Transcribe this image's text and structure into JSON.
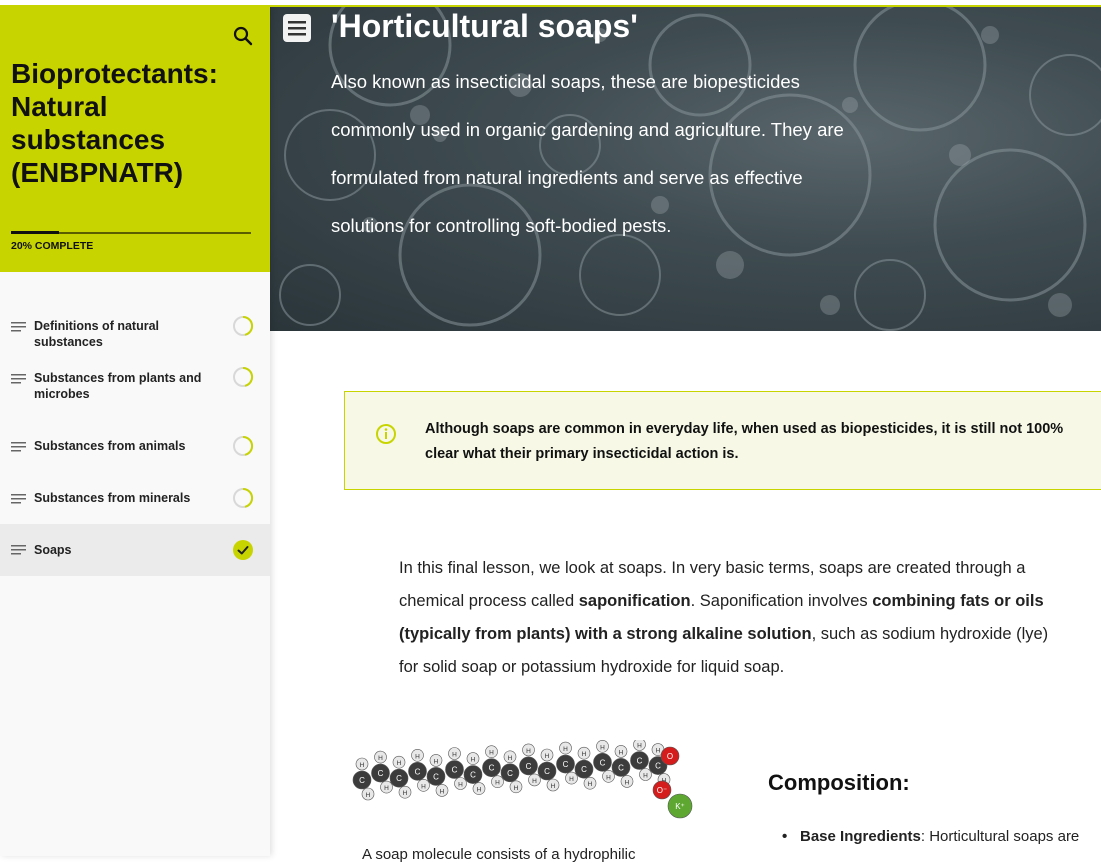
{
  "colors": {
    "accent": "#c8d400",
    "check": "#c8d400",
    "note_bg": "#f7f9e6"
  },
  "sidebar": {
    "search_icon": "search-icon",
    "course_title": "Bioprotectants: Natural substances (ENBPNATR)",
    "progress_percent": 20,
    "progress_label": "20% COMPLETE",
    "lessons": [
      {
        "label": "Definitions of natural substances",
        "status": "partial"
      },
      {
        "label": "Substances from plants and microbes",
        "status": "partial"
      },
      {
        "label": "Substances from animals",
        "status": "partial"
      },
      {
        "label": "Substances from minerals",
        "status": "partial"
      },
      {
        "label": "Soaps",
        "status": "complete",
        "active": true
      }
    ]
  },
  "hero": {
    "title": "'Horticultural soaps'",
    "text": "Also known as insecticidal soaps, these are biopesticides commonly used in organic gardening and agriculture. They are formulated from natural ingredients and serve as effective solutions for controlling soft-bodied pests."
  },
  "note": {
    "icon": "info-icon",
    "text": "Although soaps are common in everyday life, when used as biopesticides, it is still not 100% clear what their primary insecticidal action is."
  },
  "body": {
    "p1_a": "In this final lesson, we look at soaps. In very basic terms, soaps are created through a chemical process called ",
    "p1_b": "saponification",
    "p1_c": ". Saponification involves ",
    "p1_d": "combining fats or oils (typically from plants) with a strong alkaline solution",
    "p1_e": ", such as sodium hydroxide (lye) for solid soap or potassium hydroxide for liquid soap."
  },
  "molecule": {
    "atom_labels": {
      "carbon": "C",
      "hydrogen": "H",
      "oxygen": "O",
      "oxygen_ion": "O⁻",
      "potassium": "K⁺"
    }
  },
  "caption": "A soap molecule consists of a hydrophilic",
  "composition": {
    "heading": "Composition:",
    "item1_bold": "Base Ingredients",
    "item1_rest": ": Horticultural soaps are"
  }
}
